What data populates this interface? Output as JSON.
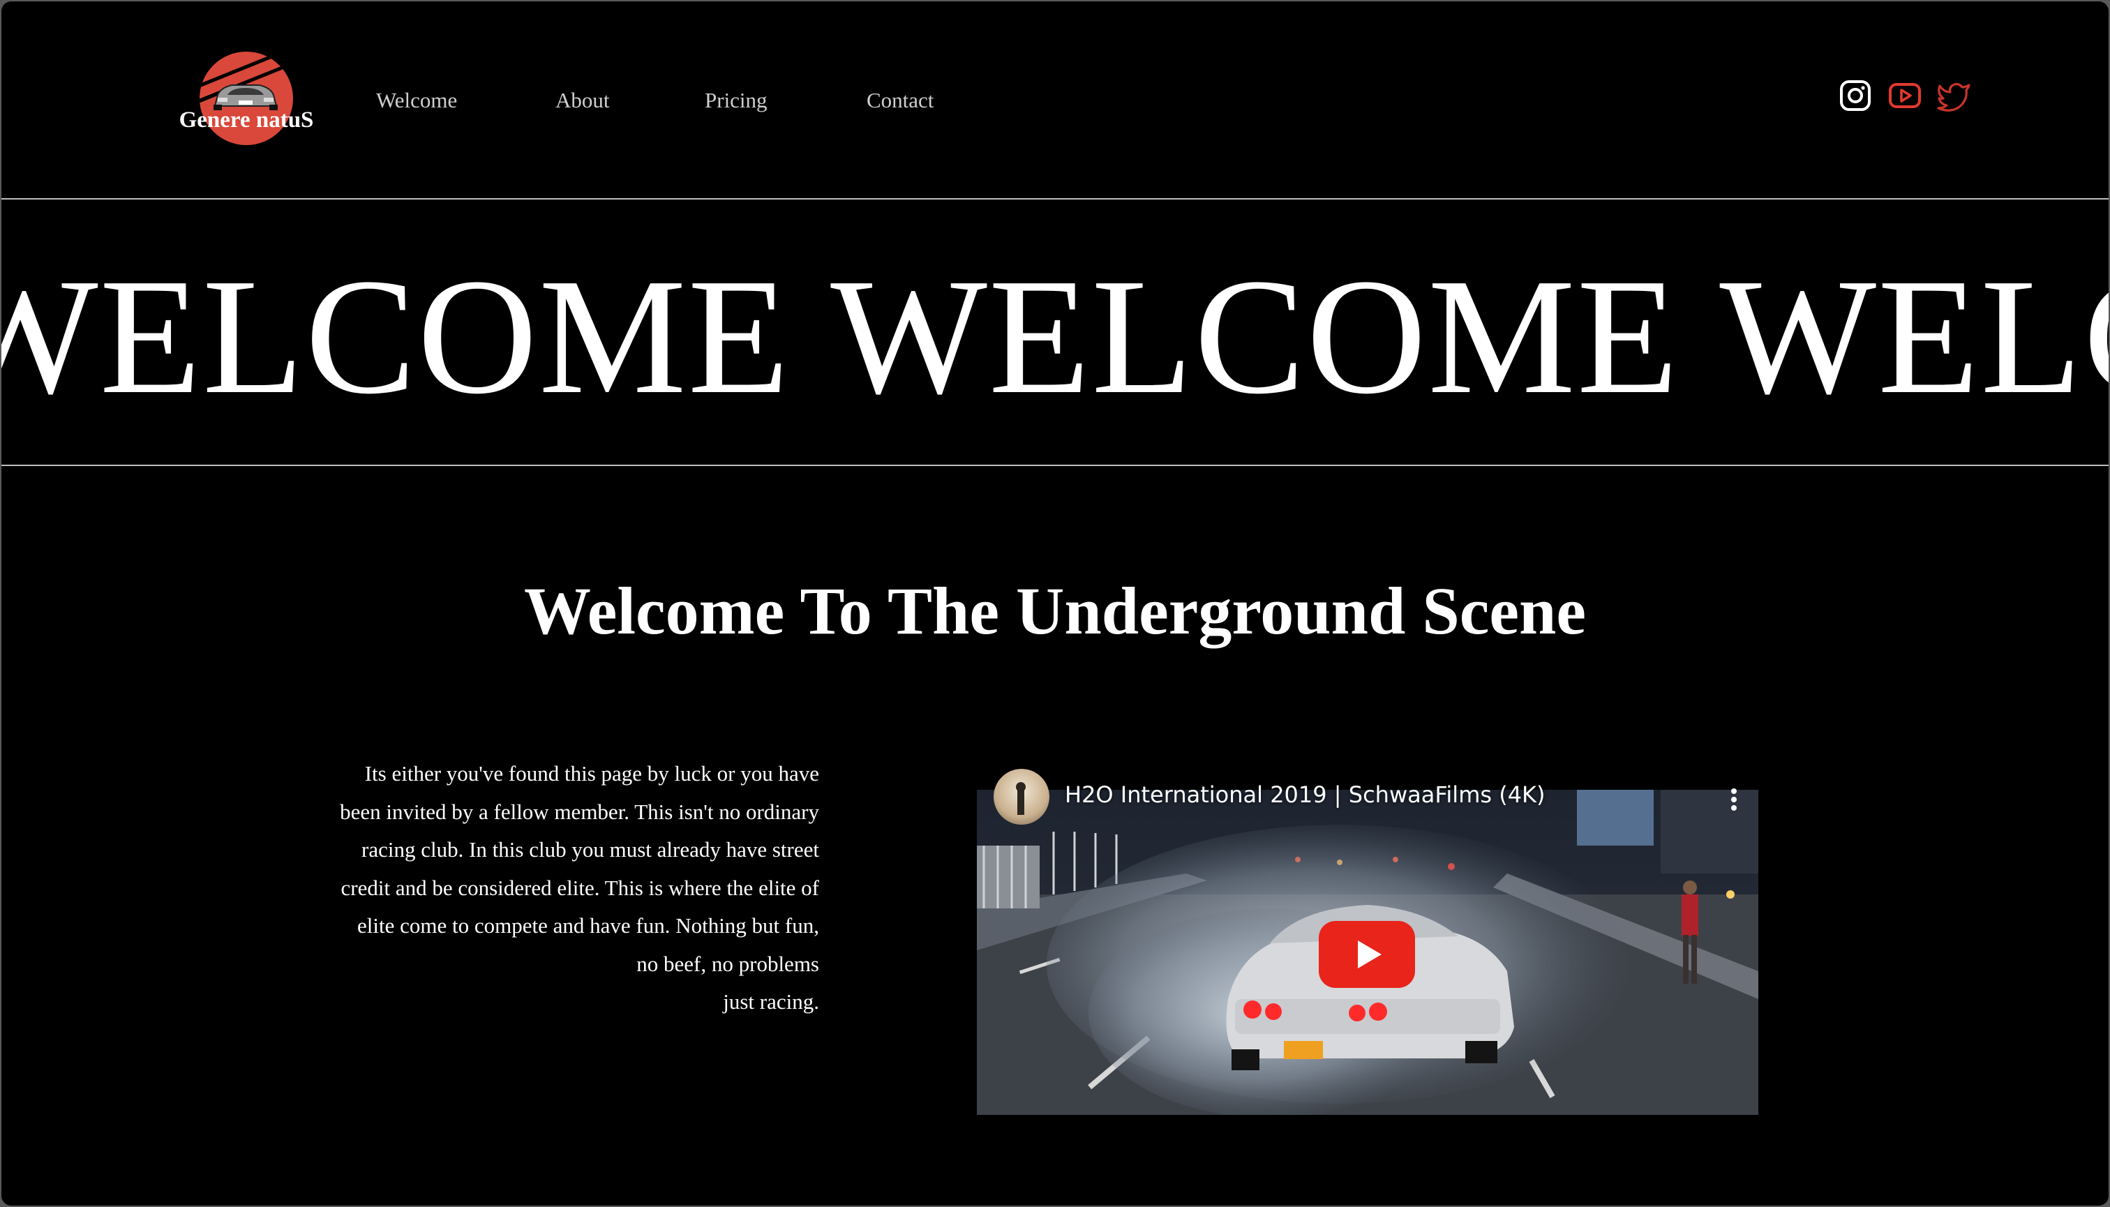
{
  "brand": {
    "name": "Genere natuS",
    "logo_colors": {
      "sun": "#d9483a",
      "car": "#9a9a9a"
    }
  },
  "nav": {
    "items": [
      {
        "label": "Welcome"
      },
      {
        "label": "About"
      },
      {
        "label": "Pricing"
      },
      {
        "label": "Contact"
      }
    ]
  },
  "social": [
    {
      "icon": "instagram-icon",
      "color": "#ffffff"
    },
    {
      "icon": "youtube-icon",
      "color": "#e23a2c"
    },
    {
      "icon": "twitter-icon",
      "color": "#c8352a"
    }
  ],
  "marquee": {
    "text": "WELCOME WELCOME WELCOME WELCOME"
  },
  "main": {
    "headline": "Welcome To The Underground Scene",
    "intro_lines": [
      "Its either you've found this page by luck or you have",
      "been invited by a fellow member. This isn't no ordinary",
      "racing club. In this club you must already have street",
      "credit and be considered elite. This is where the elite of",
      "elite come to compete and have fun. Nothing but fun,",
      "no beef, no problems",
      "just racing."
    ]
  },
  "video": {
    "title": "H2O International 2019 | SchwaaFilms (4K)",
    "play_icon": "youtube-play-icon",
    "menu_icon": "more-vertical-icon",
    "play_color": "#e8241b"
  }
}
